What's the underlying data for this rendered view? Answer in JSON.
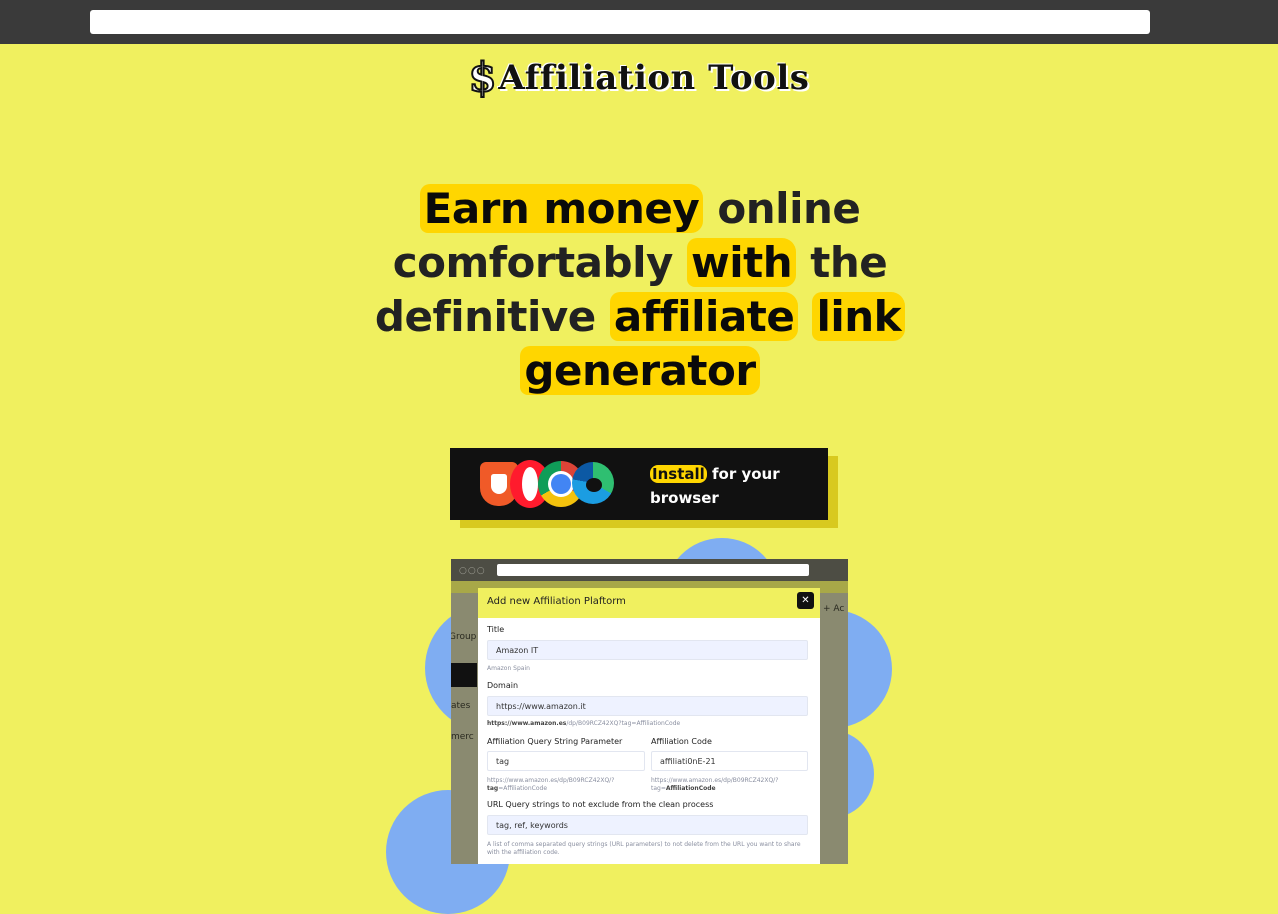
{
  "browser_url": "",
  "logo": {
    "symbol": "$",
    "text": "Affiliation Tools"
  },
  "hero": {
    "p1": "Earn money",
    "p2": " online comfortably ",
    "p3": "with",
    "p4": " the definitive ",
    "p5": "affiliate",
    "p6": " ",
    "p7": "link",
    "p8": " ",
    "p9": "generator"
  },
  "install_banner": {
    "highlight": "Install",
    "rest": " for your browser",
    "browsers": [
      "brave-icon",
      "opera-icon",
      "chrome-icon",
      "edge-icon"
    ]
  },
  "screenshot": {
    "window_dots": "○○○",
    "behind_add": "+ Ac",
    "behind_groups": "Group",
    "behind_rates": "ates",
    "behind_commerce": "merc",
    "modal": {
      "title": "Add new Affiliation Plaftorm",
      "close": "✕",
      "title_label": "Title",
      "title_value": "Amazon IT",
      "title_hint": "Amazon Spain",
      "domain_label": "Domain",
      "domain_value": "https://www.amazon.it",
      "domain_hint_bold": "https://www.amazon.es",
      "domain_hint_rest": "/dp/B09RCZ42XQ?tag=AffiliationCode",
      "param_label": "Affiliation Query String Parameter",
      "param_value": "tag",
      "param_hint_1": "https://www.amazon.es/dp/B09RCZ42XQ/?",
      "param_hint_bold": "tag",
      "param_hint_2": "=AffiliationCode",
      "code_label": "Affiliation Code",
      "code_value": "affiliati0nE-21",
      "code_hint_1": "https://www.amazon.es/dp/B09RCZ42XQ/?",
      "code_hint_2": "tag=",
      "code_hint_bold": "AffiliationCode",
      "exclude_label": "URL Query strings to not exclude from the clean process",
      "exclude_value": "tag, ref, keywords",
      "exclude_hint": "A list of comma separated query strings (URL parameters) to not delete from the URL you want to share with the affiliation code."
    }
  },
  "colors": {
    "page_bg": "#f0f05f",
    "highlight": "#ffd600",
    "bubble": "#7fadf2",
    "topbar": "#3a3a3a"
  }
}
